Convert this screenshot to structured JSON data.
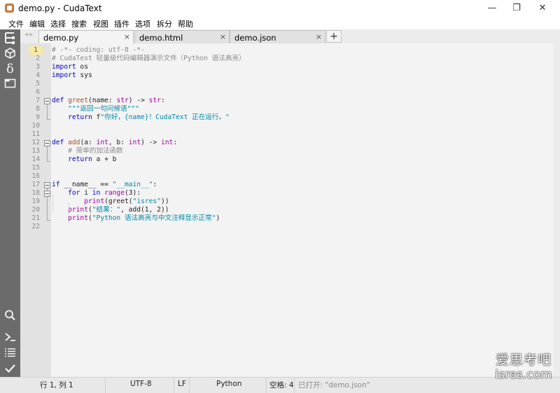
{
  "window": {
    "title": "demo.py - CudaText",
    "minimize": "—",
    "restore": "❐",
    "close": "✕"
  },
  "menu": [
    "文件",
    "编辑",
    "选择",
    "搜索",
    "视图",
    "插件",
    "选项",
    "拆分",
    "帮助"
  ],
  "sidebar": {
    "top_icons": [
      "tree-icon",
      "code-tree-icon",
      "snippets-delta-icon",
      "tabs-panel-icon"
    ],
    "bottom_icons": [
      "search-icon",
      "console-icon",
      "output-list-icon",
      "validate-check-icon"
    ]
  },
  "tabs": [
    {
      "label": "demo.py",
      "active": true
    },
    {
      "label": "demo.html",
      "active": false
    },
    {
      "label": "demo.json",
      "active": false
    }
  ],
  "tab_add": "+",
  "tab_close": "×",
  "tab_arrows": "◂▸",
  "editor": {
    "current_line": 1,
    "lines": [
      {
        "n": "1",
        "segs": [
          [
            "# -*- coding: utf-8 -*-",
            "comment"
          ]
        ]
      },
      {
        "n": "2",
        "segs": [
          [
            "# CudaText 轻量级代码编辑器演示文件（Python 语法高亮）",
            "comment"
          ]
        ]
      },
      {
        "n": "3",
        "segs": [
          [
            "import",
            "kw"
          ],
          [
            " os",
            "plain"
          ]
        ]
      },
      {
        "n": "4",
        "segs": [
          [
            "import",
            "kw"
          ],
          [
            " sys",
            "plain"
          ]
        ]
      },
      {
        "n": "5",
        "segs": []
      },
      {
        "n": "6",
        "segs": []
      },
      {
        "n": "7",
        "segs": [
          [
            "def",
            "kw"
          ],
          [
            " ",
            "plain"
          ],
          [
            "greet",
            "func"
          ],
          [
            "(name: ",
            "plain"
          ],
          [
            "str",
            "builtin"
          ],
          [
            ") -> ",
            "plain"
          ],
          [
            "str",
            "builtin"
          ],
          [
            ":",
            "plain"
          ]
        ]
      },
      {
        "n": "8",
        "segs": [
          [
            "    ",
            "plain"
          ],
          [
            "\"\"\"返回一句问候语\"\"\"",
            "string"
          ]
        ]
      },
      {
        "n": "9",
        "segs": [
          [
            "    ",
            "plain"
          ],
          [
            "return",
            "kw"
          ],
          [
            " f",
            "plain"
          ],
          [
            "\"你好，{name}！CudaText 正在运行。\"",
            "string"
          ]
        ]
      },
      {
        "n": "10",
        "segs": []
      },
      {
        "n": "11",
        "segs": []
      },
      {
        "n": "12",
        "segs": [
          [
            "def",
            "kw"
          ],
          [
            " ",
            "plain"
          ],
          [
            "add",
            "func"
          ],
          [
            "(a: ",
            "plain"
          ],
          [
            "int",
            "builtin"
          ],
          [
            ", b: ",
            "plain"
          ],
          [
            "int",
            "builtin"
          ],
          [
            ") -> ",
            "plain"
          ],
          [
            "int",
            "builtin"
          ],
          [
            ":",
            "plain"
          ]
        ]
      },
      {
        "n": "13",
        "segs": [
          [
            "    ",
            "plain"
          ],
          [
            "# 简单的加法函数",
            "comment"
          ]
        ]
      },
      {
        "n": "14",
        "segs": [
          [
            "    ",
            "plain"
          ],
          [
            "return",
            "kw"
          ],
          [
            " a + b",
            "plain"
          ]
        ]
      },
      {
        "n": "15",
        "segs": []
      },
      {
        "n": "16",
        "segs": []
      },
      {
        "n": "17",
        "segs": [
          [
            "if",
            "kw"
          ],
          [
            " __name__ == ",
            "plain"
          ],
          [
            "\"__main__\"",
            "string"
          ],
          [
            ":",
            "plain"
          ]
        ]
      },
      {
        "n": "18",
        "segs": [
          [
            "    ",
            "plain"
          ],
          [
            "for",
            "kw"
          ],
          [
            " i ",
            "plain"
          ],
          [
            "in",
            "kw"
          ],
          [
            " ",
            "plain"
          ],
          [
            "range",
            "builtin"
          ],
          [
            "(3):",
            "plain"
          ]
        ]
      },
      {
        "n": "19",
        "segs": [
          [
            "        ",
            "plain"
          ],
          [
            "print",
            "builtin"
          ],
          [
            "(greet(",
            "plain"
          ],
          [
            "\"isres\"",
            "string"
          ],
          [
            "))",
            "plain"
          ]
        ]
      },
      {
        "n": "20",
        "segs": [
          [
            "    ",
            "plain"
          ],
          [
            "print",
            "builtin"
          ],
          [
            "(",
            "plain"
          ],
          [
            "\"结果：\"",
            "string"
          ],
          [
            ", add(1, 2))",
            "plain"
          ]
        ]
      },
      {
        "n": "21",
        "segs": [
          [
            "    ",
            "plain"
          ],
          [
            "print",
            "builtin"
          ],
          [
            "(",
            "plain"
          ],
          [
            "\"Python 语法高亮与中文注释显示正常\"",
            "string"
          ],
          [
            ")",
            "plain"
          ]
        ]
      },
      {
        "n": "22",
        "segs": []
      }
    ]
  },
  "colors": {
    "comment": "#8a8a8a",
    "kw": "#0000c8",
    "func": "#a0522d",
    "builtin": "#a000a0",
    "string": "#0088a8",
    "plain": "#1e1e1e"
  },
  "status": {
    "position": "行 1, 列 1",
    "encoding": "UTF-8",
    "line_ending": "LF",
    "lexer": "Python",
    "indent": "空格: 4",
    "message": "已打开: \"demo.json\""
  },
  "watermark": {
    "line1": "爱思考吧",
    "line2": "isres.com"
  }
}
